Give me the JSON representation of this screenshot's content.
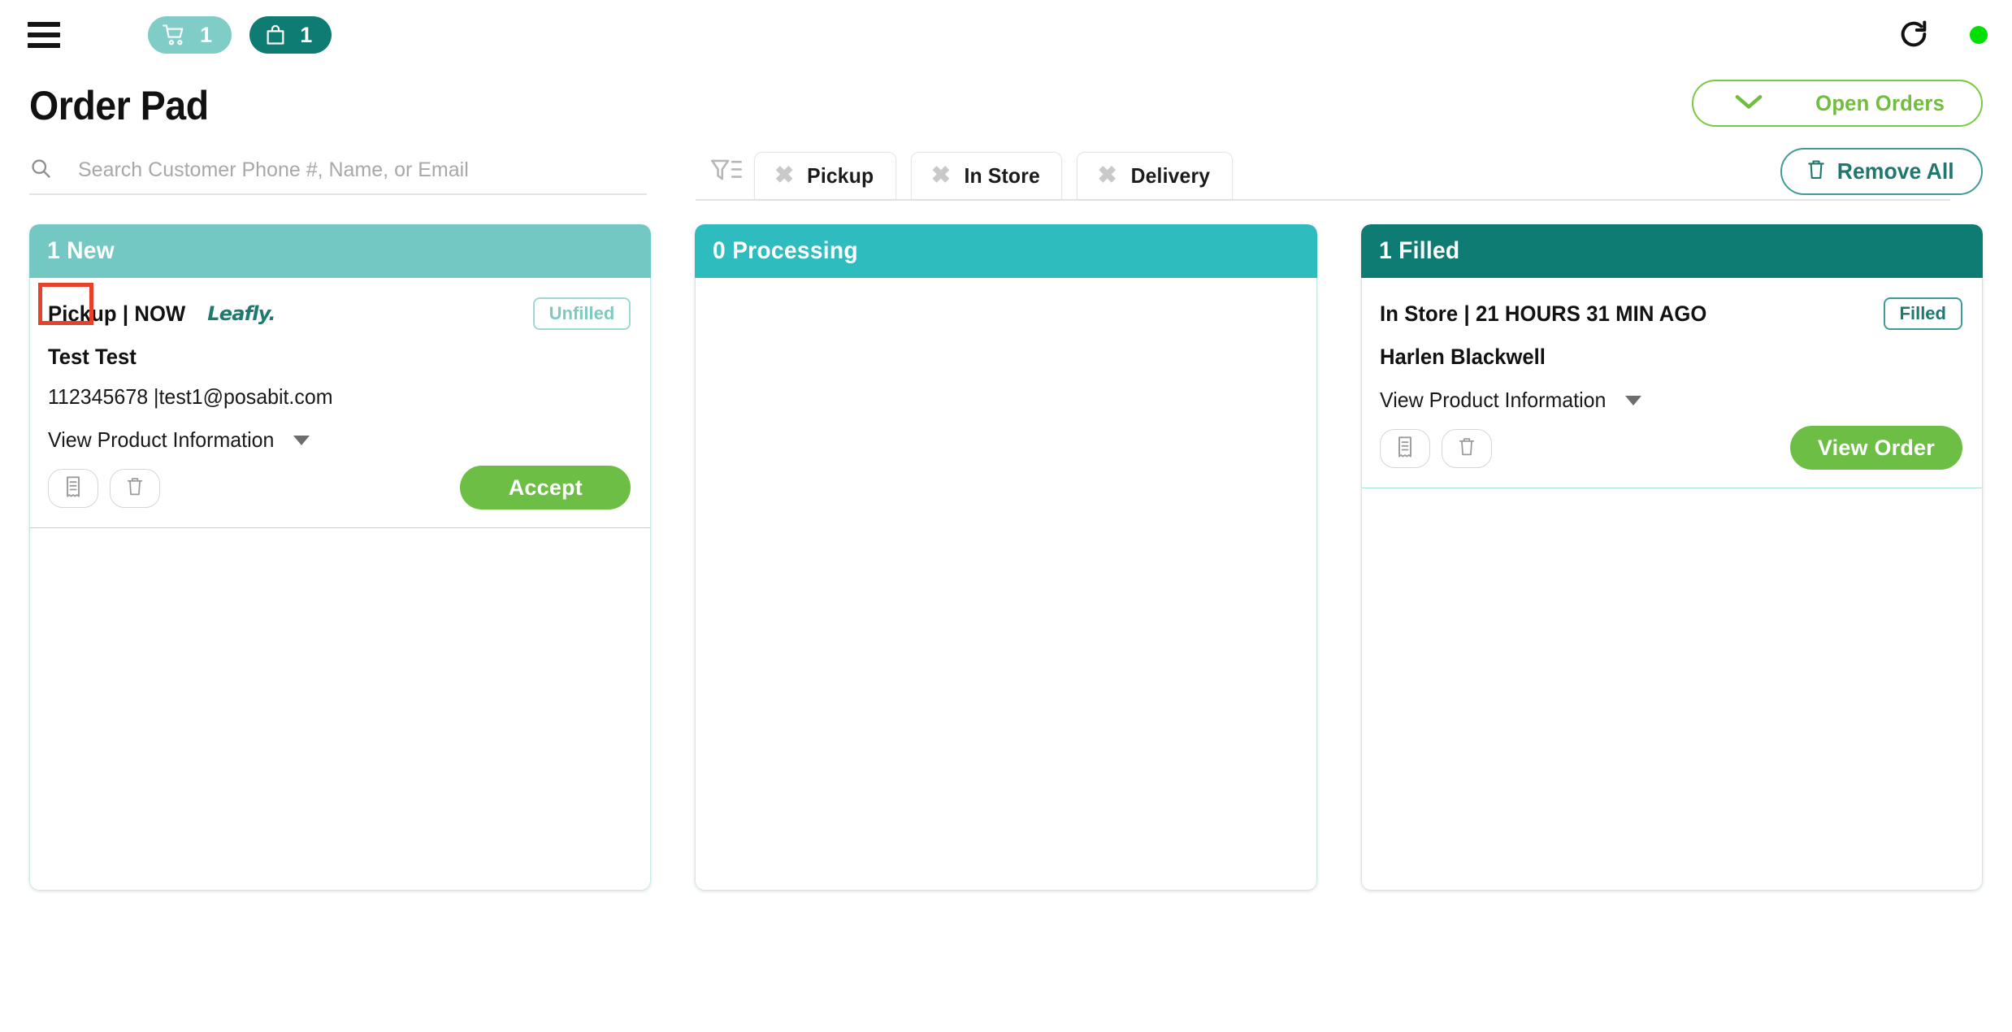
{
  "topbar": {
    "menu_icon": "hamburger-menu-icon",
    "cart_badge": {
      "icon": "shopping-cart-icon",
      "count": "1"
    },
    "bag_badge": {
      "icon": "shopping-bag-icon",
      "count": "1"
    },
    "refresh_icon": "refresh-icon",
    "status_indicator": {
      "name": "online-status-dot",
      "color": "#00e000"
    }
  },
  "header": {
    "title": "Order Pad",
    "open_orders_button": {
      "label": "Open Orders",
      "icon": "chevron-down-icon",
      "color": "#71be3e"
    }
  },
  "search": {
    "icon": "search-icon",
    "value": "",
    "placeholder": "Search Customer Phone #, Name, or Email"
  },
  "filters": {
    "icon": "filter-icon",
    "chips": [
      {
        "label": "Pickup",
        "remove_icon": "close-x-icon"
      },
      {
        "label": "In Store",
        "remove_icon": "close-x-icon"
      },
      {
        "label": "Delivery",
        "remove_icon": "close-x-icon"
      }
    ],
    "remove_all_button": {
      "label": "Remove All",
      "icon": "trash-icon",
      "color": "#20776f"
    }
  },
  "columns": [
    {
      "title": "1 New",
      "header_color": "#73c8c3",
      "card": {
        "type_line": "Pickup | NOW",
        "source_mark": "Leafly.",
        "source_highlighted": true,
        "status_badge": "Unfilled",
        "status_variant": "unfilled",
        "customer_name": "Test Test",
        "contact": "112345678 |test1@posabit.com",
        "view_product_label": "View Product Information",
        "receipt_icon": "receipt-icon",
        "delete_icon": "trash-icon",
        "primary_action": "Accept"
      }
    },
    {
      "title": "0 Processing",
      "header_color": "#2fbcbf",
      "card": null
    },
    {
      "title": "1 Filled",
      "header_color": "#0f7c74",
      "card": {
        "type_line": "In Store | 21 HOURS 31 MIN AGO",
        "source_mark": "",
        "source_highlighted": false,
        "status_badge": "Filled",
        "status_variant": "filled",
        "customer_name": "Harlen Blackwell",
        "contact": "",
        "view_product_label": "View Product Information",
        "receipt_icon": "receipt-icon",
        "delete_icon": "trash-icon",
        "primary_action": "View Order"
      }
    }
  ]
}
